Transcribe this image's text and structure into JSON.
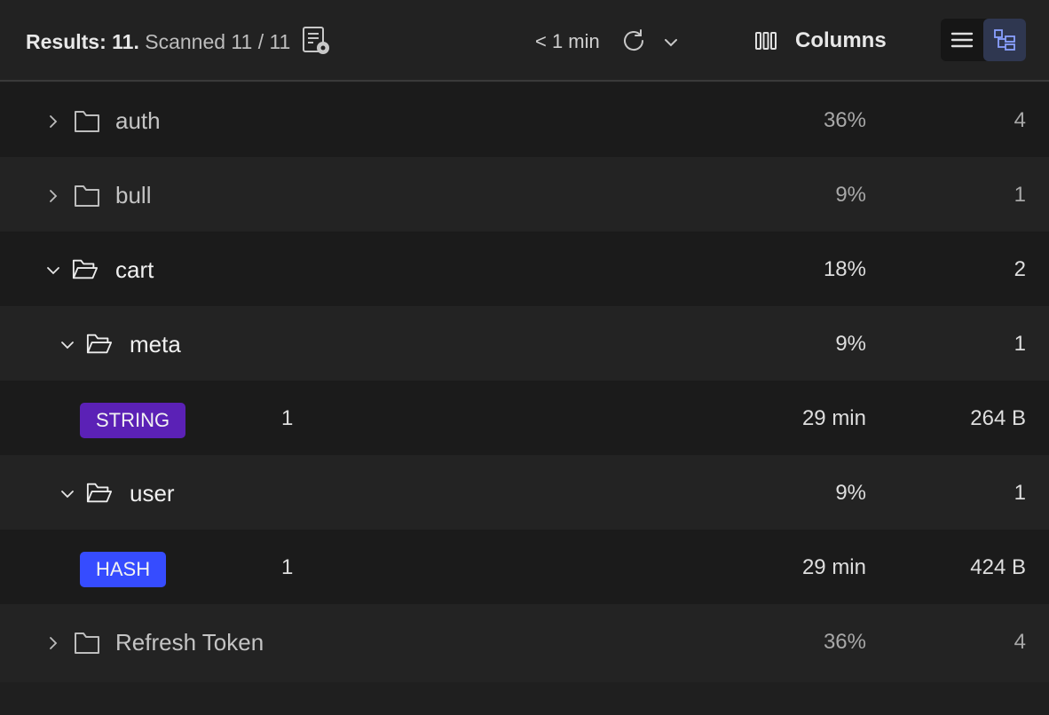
{
  "toolbar": {
    "results_label": "Results: 11.",
    "scanned_label": "Scanned 11 / 11",
    "refresh_time": "< 1 min",
    "columns_label": "Columns"
  },
  "colors": {
    "string_badge": "#5b21b6",
    "hash_badge": "#364cff",
    "active_view_icon": "#8aa0ff"
  },
  "tree": {
    "auth": {
      "name": "auth",
      "percent": "36%",
      "count": "4"
    },
    "bull": {
      "name": "bull",
      "percent": "9%",
      "count": "1"
    },
    "cart": {
      "name": "cart",
      "percent": "18%",
      "count": "2"
    },
    "meta": {
      "name": "meta",
      "percent": "9%",
      "count": "1"
    },
    "meta_key": {
      "type": "STRING",
      "count": "1",
      "ttl": "29 min",
      "size": "264 B"
    },
    "user": {
      "name": "user",
      "percent": "9%",
      "count": "1"
    },
    "user_key": {
      "type": "HASH",
      "count": "1",
      "ttl": "29 min",
      "size": "424 B"
    },
    "refresh_token": {
      "name": "Refresh Token",
      "percent": "36%",
      "count": "4"
    }
  }
}
